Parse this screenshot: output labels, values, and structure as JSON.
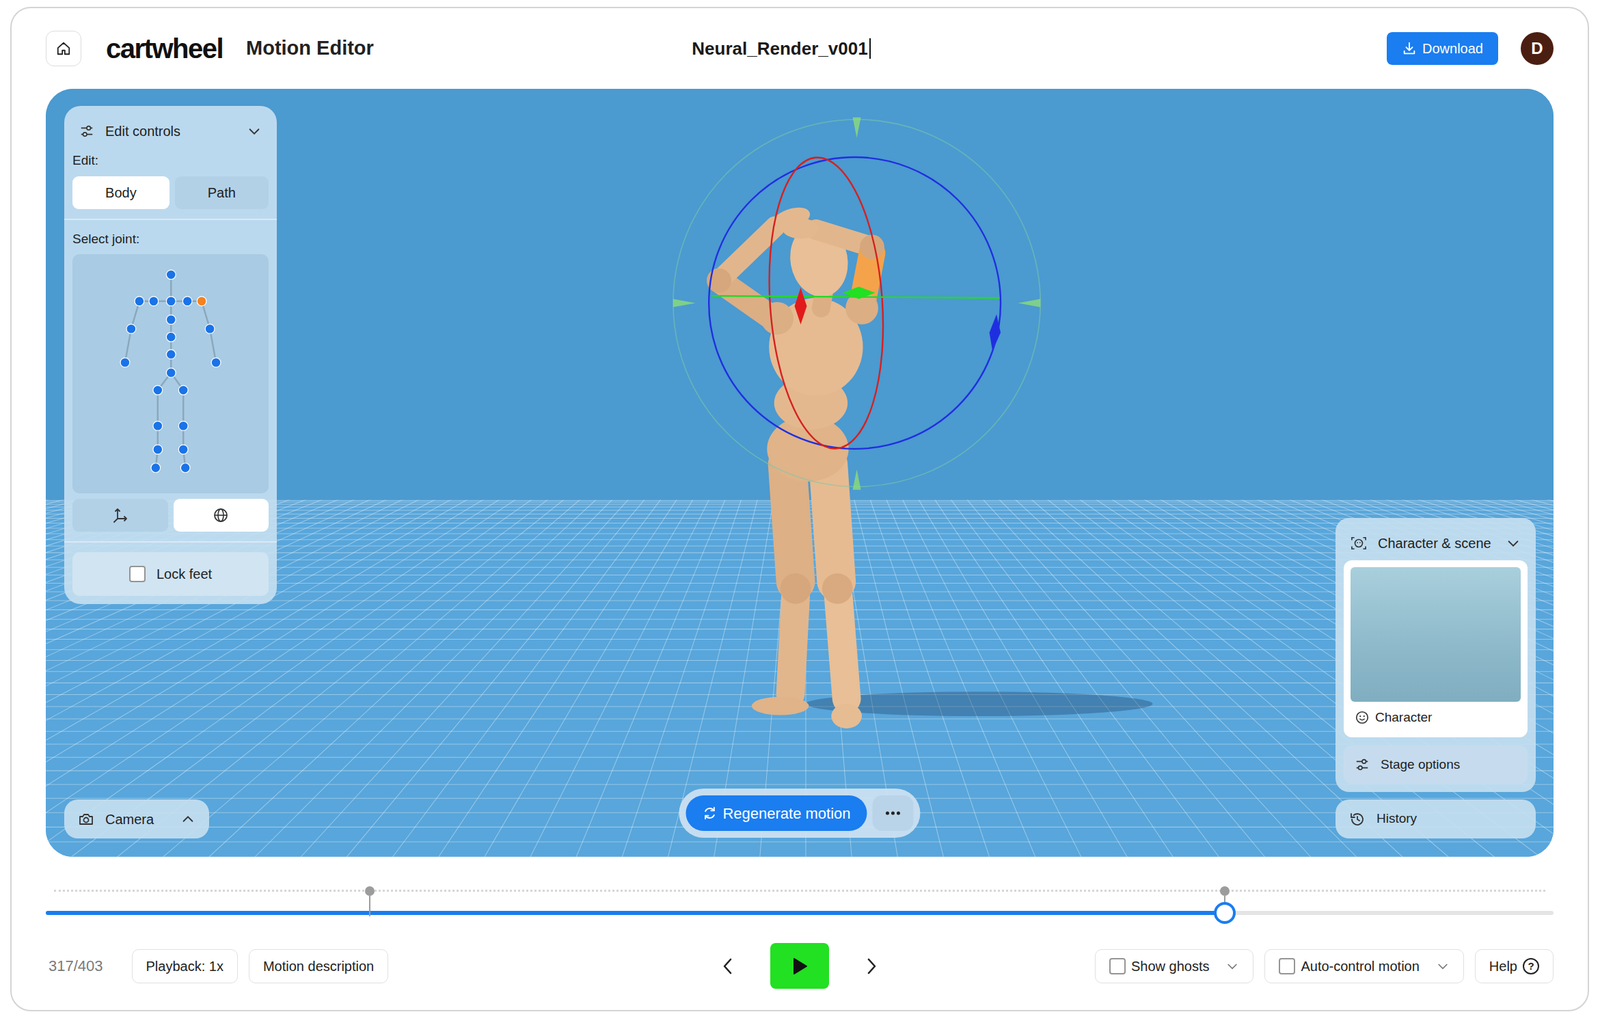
{
  "header": {
    "logo": "cartwheel",
    "app_name": "Motion Editor",
    "file_name": "Neural_Render_v001",
    "editing": true,
    "download": "Download",
    "avatar": "D"
  },
  "edit_controls": {
    "title": "Edit controls",
    "expanded": true,
    "edit_label": "Edit:",
    "modes": [
      {
        "label": "Body",
        "selected": true
      },
      {
        "label": "Path",
        "selected": false
      }
    ],
    "joint_label": "Select joint:",
    "joints": [
      {
        "selected": false
      },
      {
        "selected": false
      },
      {
        "selected": false
      },
      {
        "selected": false
      },
      {
        "selected": false
      },
      {
        "selected": true
      },
      {
        "selected": false
      },
      {
        "selected": false
      },
      {
        "selected": false
      },
      {
        "selected": false
      },
      {
        "selected": false
      },
      {
        "selected": false
      },
      {
        "selected": false
      },
      {
        "selected": false
      },
      {
        "selected": false
      },
      {
        "selected": false
      },
      {
        "selected": false
      },
      {
        "selected": false
      },
      {
        "selected": false
      },
      {
        "selected": false
      },
      {
        "selected": false
      },
      {
        "selected": false
      }
    ],
    "tools": [
      {
        "kind": "translate",
        "selected": false
      },
      {
        "kind": "rotate",
        "selected": true
      }
    ],
    "lock_feet": {
      "label": "Lock feet",
      "checked": false
    }
  },
  "camera": {
    "label": "Camera",
    "expanded": false
  },
  "regenerate": {
    "label": "Regenerate motion"
  },
  "character_scene": {
    "title": "Character & scene",
    "expanded": true,
    "character": "Character",
    "stage_options": "Stage options"
  },
  "history": {
    "label": "History"
  },
  "timeline": {
    "level": 0.782,
    "keyframes": [
      {
        "level": 0.215
      },
      {
        "level": 0.782
      }
    ]
  },
  "toolbar": {
    "frame": "317/403",
    "playback": "Playback: 1x",
    "motion_description": "Motion description",
    "playing": false,
    "show_ghosts": {
      "label": "Show ghosts",
      "checked": false
    },
    "auto_control": {
      "label": "Auto-control motion",
      "checked": false
    },
    "help": "Help",
    "help_icon": "?"
  }
}
